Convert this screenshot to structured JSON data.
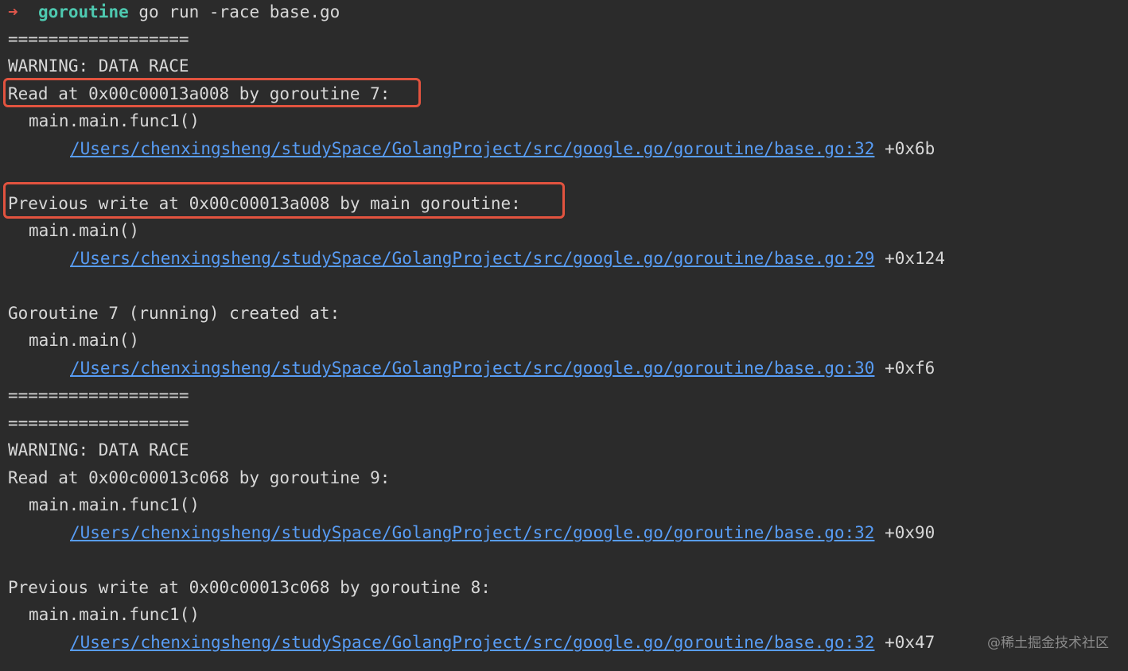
{
  "prompt": {
    "arrow": "➜",
    "directory": "goroutine",
    "command": "go run -race base.go"
  },
  "output": {
    "separator": "==================",
    "race1": {
      "warning": "WARNING: DATA RACE",
      "read": "Read at 0x00c00013a008 by goroutine 7:",
      "read_func": "main.main.func1()",
      "read_path": "/Users/chenxingsheng/studySpace/GolangProject/src/google.go/goroutine/base.go:32",
      "read_offset": "+0x6b",
      "write": "Previous write at 0x00c00013a008 by main goroutine:",
      "write_func": "main.main()",
      "write_path": "/Users/chenxingsheng/studySpace/GolangProject/src/google.go/goroutine/base.go:29",
      "write_offset": "+0x124",
      "created": "Goroutine 7 (running) created at:",
      "created_func": "main.main()",
      "created_path": "/Users/chenxingsheng/studySpace/GolangProject/src/google.go/goroutine/base.go:30",
      "created_offset": "+0xf6"
    },
    "race2": {
      "warning": "WARNING: DATA RACE",
      "read": "Read at 0x00c00013c068 by goroutine 9:",
      "read_func": "main.main.func1()",
      "read_path": "/Users/chenxingsheng/studySpace/GolangProject/src/google.go/goroutine/base.go:32",
      "read_offset": "+0x90",
      "write": "Previous write at 0x00c00013c068 by goroutine 8:",
      "write_func": "main.main.func1()",
      "write_path": "/Users/chenxingsheng/studySpace/GolangProject/src/google.go/goroutine/base.go:32",
      "write_offset": "+0x47"
    }
  },
  "watermark": "@稀土掘金技术社区",
  "colors": {
    "background": "#2b2b2b",
    "text": "#d8d8d8",
    "link": "#589df6",
    "highlight": "#e2533f",
    "prompt_dir": "#4ec9b0"
  }
}
